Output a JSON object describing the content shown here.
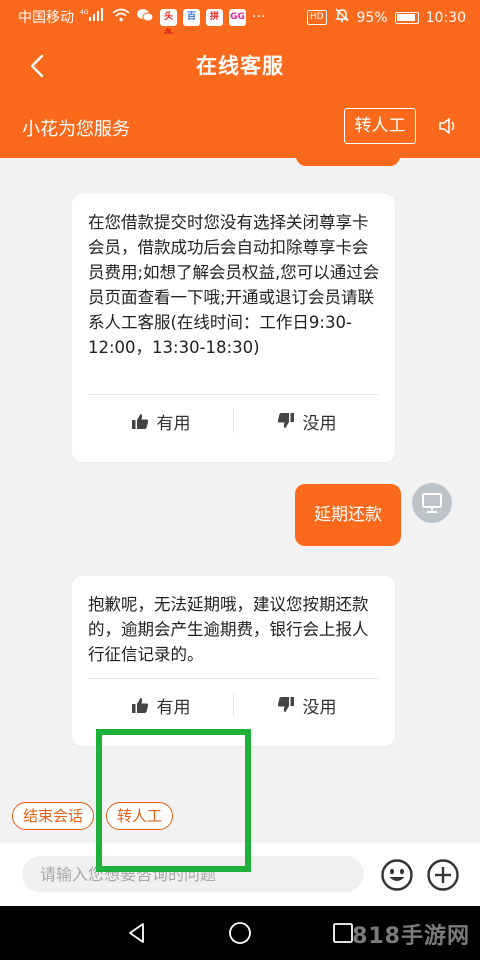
{
  "status_bar": {
    "carrier": "中国移动",
    "network": "4G",
    "app_badges": [
      "头条",
      "百",
      "拼",
      "GG"
    ],
    "more": "···",
    "hd": "HD",
    "battery": "95%",
    "time": "10:30"
  },
  "header": {
    "title": "在线客服",
    "subtitle": "小花为您服务",
    "transfer_label": "转人工"
  },
  "messages": [
    {
      "type": "bot",
      "text": "在您借款提交时您没有选择关闭尊享卡会员，借款成功后会自动扣除尊享卡会员费用;如想了解会员权益,您可以通过会员页面查看一下哦;开通或退订会员请联系人工客服(在线时间：工作日9:30-12:00，13:30-18:30)",
      "useful_label": "有用",
      "useless_label": "没用"
    },
    {
      "type": "user",
      "text": "延期还款"
    },
    {
      "type": "bot",
      "text": "抱歉呢，无法延期哦，建议您按期还款的，逾期会产生逾期费，银行会上报人行征信记录的。",
      "useful_label": "有用",
      "useless_label": "没用"
    }
  ],
  "quick_actions": [
    "结束会话",
    "转人工"
  ],
  "input": {
    "placeholder": "请输入您想要咨询的问题"
  },
  "watermark": "818手游网",
  "colors": {
    "brand": "#fb6a1c",
    "highlight": "#1fb13a"
  }
}
